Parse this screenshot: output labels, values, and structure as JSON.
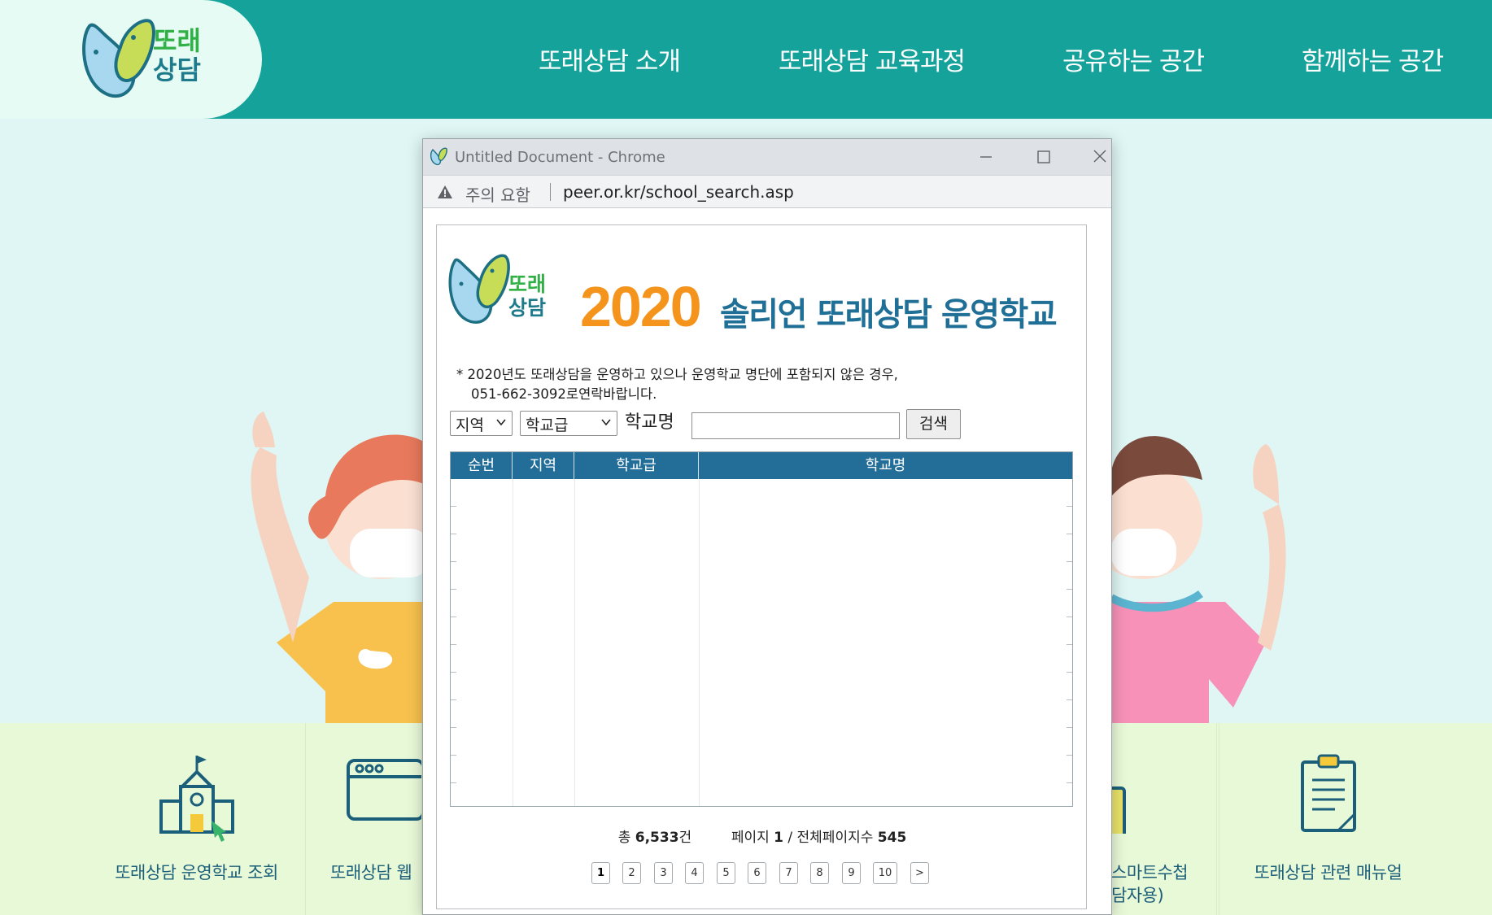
{
  "site": {
    "logo_line1": "또래",
    "logo_line2": "상담",
    "nav": [
      "또래상담 소개",
      "또래상담 교육과정",
      "공유하는 공간",
      "함께하는 공간"
    ]
  },
  "quick_links": [
    {
      "label": "또래상담 운영학교 조회",
      "icon": "school-icon"
    },
    {
      "label": "또래상담 웹",
      "icon": "web-window-icon"
    },
    {
      "label": "스마트수첩",
      "label2": "담자용)",
      "icon": "smart-notebook-icon"
    },
    {
      "label": "또래상담 관련 매뉴얼",
      "icon": "clipboard-icon"
    }
  ],
  "popup": {
    "window_title": "Untitled Document - Chrome",
    "security_warning": "주의 요함",
    "url": "peer.or.kr/school_search.asp",
    "logo_line1": "또래",
    "logo_line2": "상담",
    "year": "2020",
    "heading": "솔리언 또래상담 운영학교",
    "notice_line1": "* 2020년도 또래상담을 운영하고 있으나 운영학교 명단에 포함되지 않은 경우,",
    "notice_line2": "051-662-3092로연락바랍니다.",
    "region_select": "지역",
    "level_select": "학교급",
    "school_name_label": "학교명",
    "search_input_value": "",
    "search_button": "검색",
    "table_headers": [
      "순번",
      "지역",
      "학교급",
      "학교명"
    ],
    "table_rows": [],
    "total_prefix": "총",
    "total_count": "6,533",
    "total_suffix": "건",
    "page_label": "페이지",
    "current_page": "1",
    "total_pages_label": "/ 전체페이지수",
    "total_pages": "545",
    "pages": [
      "1",
      "2",
      "3",
      "4",
      "5",
      "6",
      "7",
      "8",
      "9",
      "10",
      ">"
    ]
  },
  "colors": {
    "nav_bg": "#14a29a",
    "table_header": "#226e98",
    "year_orange": "#f4941c",
    "heading_blue": "#1f6f96"
  }
}
